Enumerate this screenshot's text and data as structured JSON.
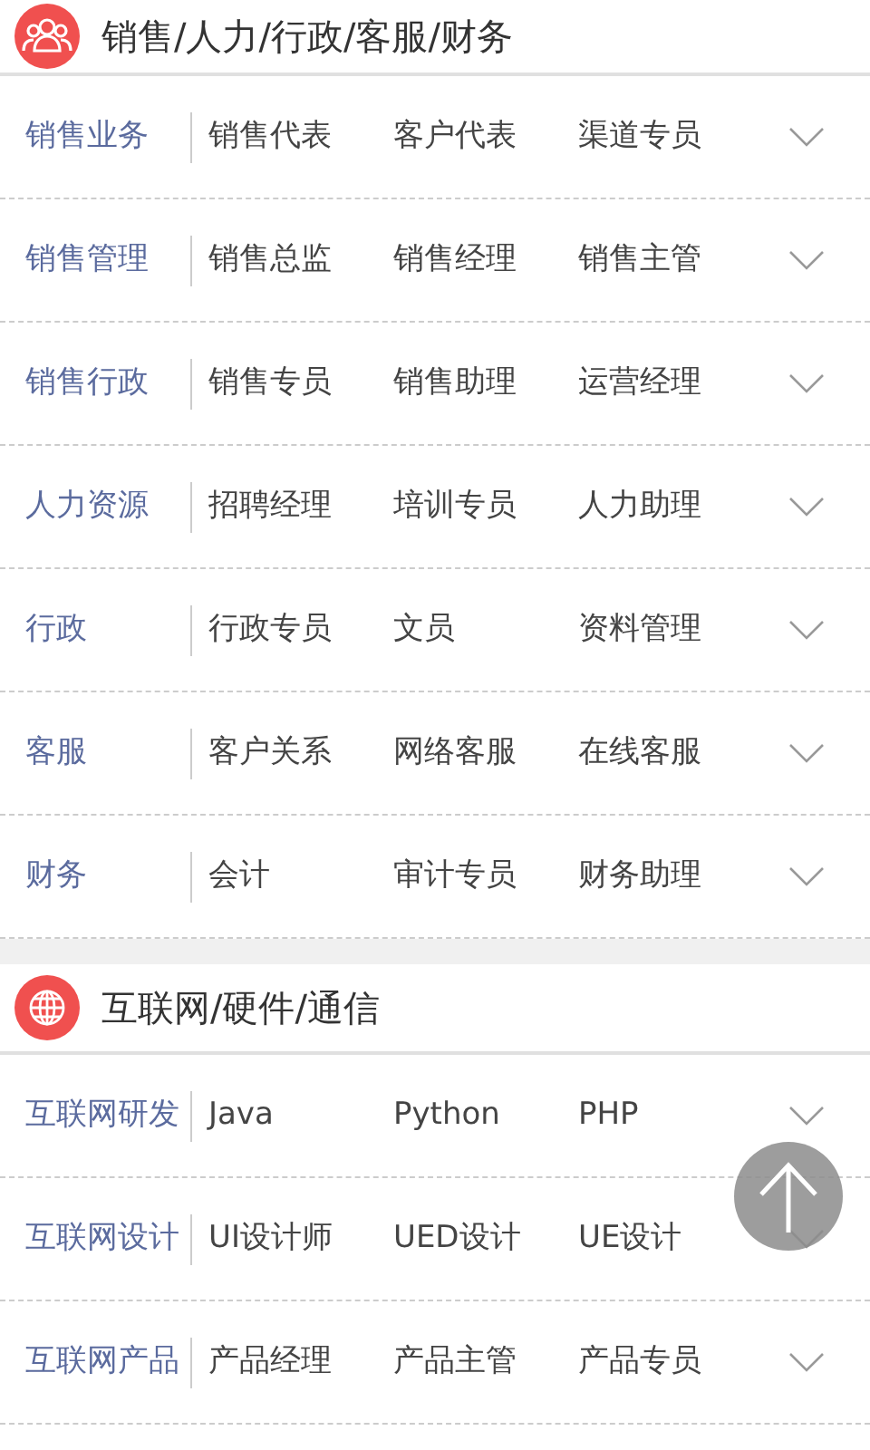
{
  "sections": [
    {
      "title": "销售/人力/行政/客服/财务",
      "rows": [
        {
          "category": "销售业务",
          "jobs": [
            "销售代表",
            "客户代表",
            "渠道专员"
          ]
        },
        {
          "category": "销售管理",
          "jobs": [
            "销售总监",
            "销售经理",
            "销售主管"
          ]
        },
        {
          "category": "销售行政",
          "jobs": [
            "销售专员",
            "销售助理",
            "运营经理"
          ]
        },
        {
          "category": "人力资源",
          "jobs": [
            "招聘经理",
            "培训专员",
            "人力助理"
          ]
        },
        {
          "category": "行政",
          "jobs": [
            "行政专员",
            "文员",
            "资料管理"
          ]
        },
        {
          "category": "客服",
          "jobs": [
            "客户关系",
            "网络客服",
            "在线客服"
          ]
        },
        {
          "category": "财务",
          "jobs": [
            "会计",
            "审计专员",
            "财务助理"
          ]
        }
      ]
    },
    {
      "title": "互联网/硬件/通信",
      "rows": [
        {
          "category": "互联网研发",
          "jobs": [
            "Java",
            "Python",
            "PHP"
          ]
        },
        {
          "category": "互联网设计",
          "jobs": [
            "UI设计师",
            "UED设计",
            "UE设计"
          ]
        },
        {
          "category": "互联网产品",
          "jobs": [
            "产品经理",
            "产品主管",
            "产品专员"
          ]
        }
      ]
    }
  ]
}
